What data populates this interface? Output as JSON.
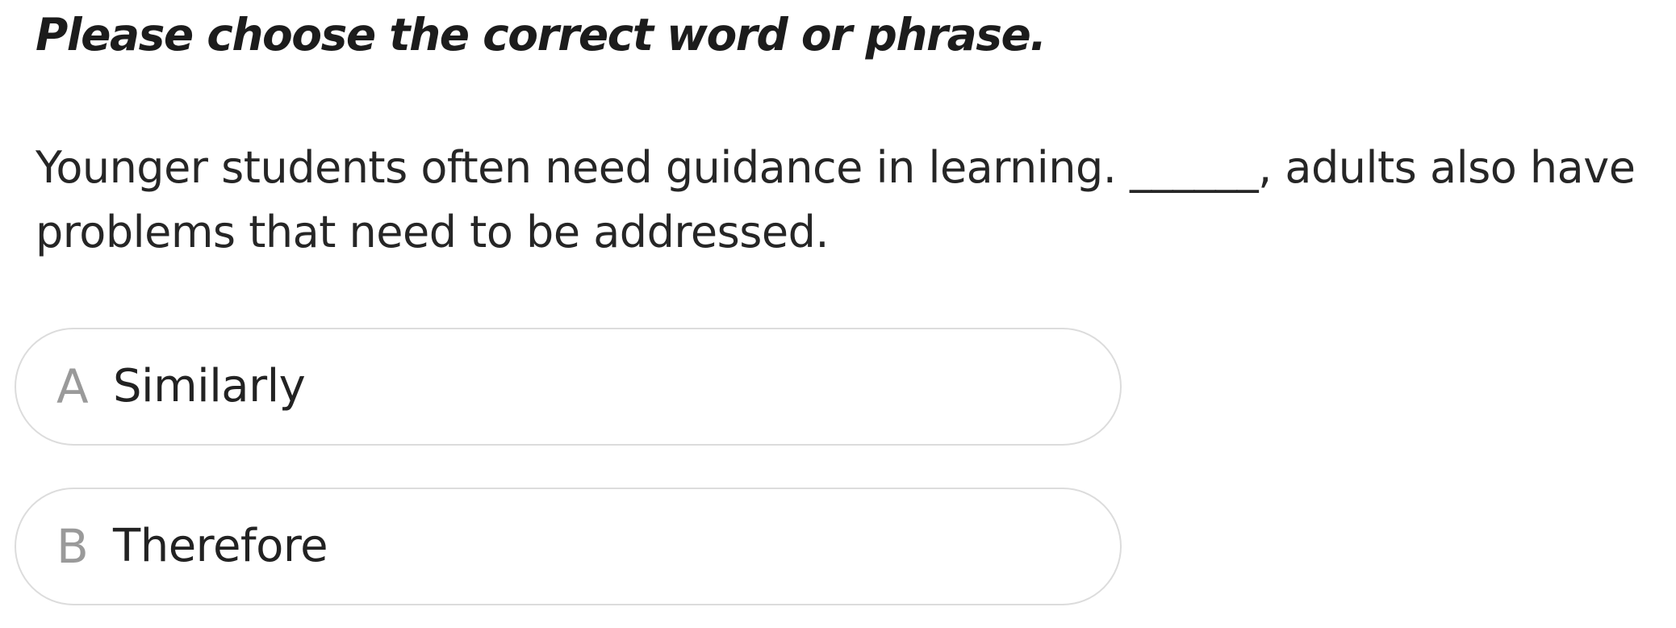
{
  "instruction": "Please choose the correct word or phrase.",
  "question": {
    "text": "Younger students often need guidance in learning. ______, adults also have problems that need to be addressed."
  },
  "options": [
    {
      "letter": "A",
      "text": "Similarly"
    },
    {
      "letter": "B",
      "text": "Therefore"
    }
  ],
  "colors": {
    "option_border": "#dcdcdc",
    "option_letter": "#9a9a9a",
    "text": "#262626"
  }
}
